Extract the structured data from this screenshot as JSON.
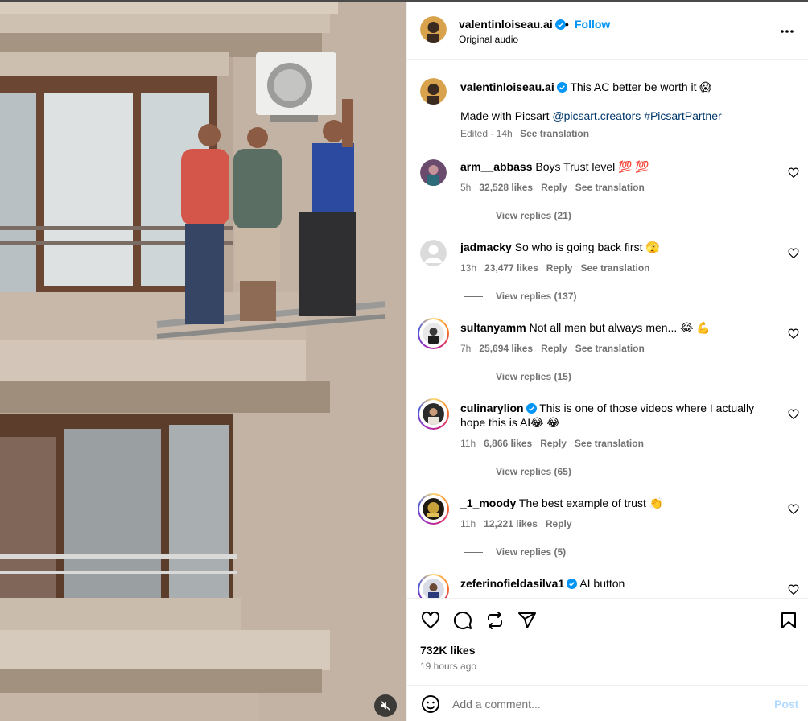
{
  "post": {
    "author": "valentinloiseau.ai",
    "follow_label": "Follow",
    "separator": "•",
    "audio": "Original audio",
    "caption": "This AC better be worth it 😱",
    "caption_line2_prefix": "Made with Picsart ",
    "caption_mention": "@picsart.creators",
    "caption_hashtag": "#PicsartPartner",
    "caption_meta": "Edited · 14h",
    "see_translation": "See translation"
  },
  "comments": [
    {
      "user": "arm__abbass",
      "text": "Boys Trust level 💯 💯",
      "time": "5h",
      "likes": "32,528 likes",
      "reply": "Reply",
      "translate": "See translation",
      "replies": "View replies (21)",
      "verified": false
    },
    {
      "user": "jadmacky",
      "text": "So who is going back first 🫣",
      "time": "13h",
      "likes": "23,477 likes",
      "reply": "Reply",
      "translate": "See translation",
      "replies": "View replies (137)",
      "verified": false
    },
    {
      "user": "sultanyamm",
      "text": "Not all men but always men... 😂 💪",
      "time": "7h",
      "likes": "25,694 likes",
      "reply": "Reply",
      "translate": "See translation",
      "replies": "View replies (15)",
      "verified": false
    },
    {
      "user": "culinarylion",
      "text": "This is one of those videos where I actually hope this is AI😂 😂",
      "time": "11h",
      "likes": "6,866 likes",
      "reply": "Reply",
      "translate": "See translation",
      "replies": "View replies (65)",
      "verified": true
    },
    {
      "user": "_1_moody",
      "text": "The best example of trust 👏",
      "time": "11h",
      "likes": "12,221 likes",
      "reply": "Reply",
      "replies": "View replies (5)",
      "verified": false
    },
    {
      "user": "zeferinofieldasilva1",
      "text": "AI button",
      "verified": true
    }
  ],
  "stats": {
    "likes": "732K likes",
    "time": "19 hours ago"
  },
  "composer": {
    "placeholder": "Add a comment...",
    "post_label": "Post"
  },
  "colors": {
    "link": "#0095f6",
    "verified": "#0095f6",
    "muted": "#737373"
  }
}
